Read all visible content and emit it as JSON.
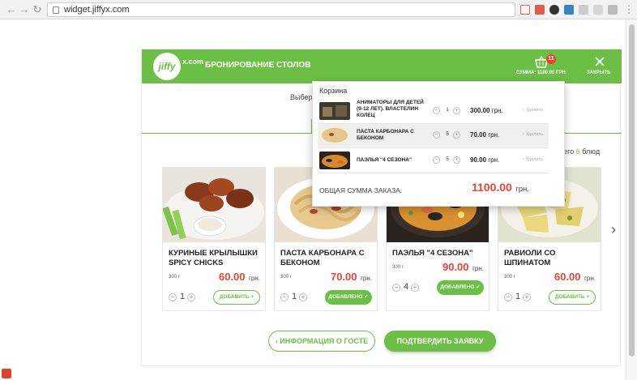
{
  "browser": {
    "url": "widget.jiffyx.com",
    "back_icon": "arrow-left-icon",
    "forward_icon": "arrow-right-icon",
    "reload_icon": "reload-icon"
  },
  "header": {
    "logo_text": "jiffy",
    "logo_suffix": "x.com",
    "title": "БРОНИРОВАНИЕ СТОЛОВ",
    "cart_badge": "11",
    "cart_sum": "СУММА: 1100.00 ГРН.",
    "close_label": "ЗАКРЫТЬ"
  },
  "main": {
    "subtitle": "Выбери",
    "count_prefix": "всего ",
    "count_num": "6",
    "count_suffix": " блюд"
  },
  "cards": [
    {
      "name": "КУРИНЫЕ КРЫЛЫШКИ SPICY CHICKS",
      "weight": "300 г",
      "price": "60.00",
      "currency": "грн.",
      "qty": "1",
      "button": "ДОБАВИТЬ +",
      "added": false
    },
    {
      "name": "ПАСТА КАРБОНАРА С БЕКОНОМ",
      "weight": "300 г",
      "price": "70.00",
      "currency": "грн.",
      "qty": "1",
      "button": "ДОБАВЛЕНО ✓",
      "added": true
    },
    {
      "name": "ПАЭЛЬЯ \"4 СЕЗОНА\"",
      "weight": "300 г",
      "price": "90.00",
      "currency": "грн.",
      "qty": "4",
      "button": "ДОБАВЛЕНО ✓",
      "added": true
    },
    {
      "name": "РАВИОЛИ СО ШПИНАТОМ",
      "weight": "300 г",
      "price": "60.00",
      "currency": "грн.",
      "qty": "1",
      "button": "ДОБАВИТЬ +",
      "added": false
    }
  ],
  "buttons": {
    "guest_info": "‹ ИНФОРМАЦИЯ О ГОСТЕ",
    "confirm": "ПОДТВЕРДИТЬ ЗАЯВКУ"
  },
  "cart_popup": {
    "title": "Корзина",
    "items": [
      {
        "name": "АНИМАТОРЫ ДЛЯ ДЕТЕЙ (9-12 ЛЕТ). ВЛАСТЕЛИН КОЛЕЦ",
        "qty": "1",
        "price": "300.00",
        "currency": "грн.",
        "remove": "Удалить"
      },
      {
        "name": "ПАСТА КАРБОНАРА С БЕКОНОМ",
        "qty": "5",
        "price": "70.00",
        "currency": "грн.",
        "remove": "Удалить"
      },
      {
        "name": "ПАЭЛЬЯ \"4 СЕЗОНА\"",
        "qty": "5",
        "price": "90.00",
        "currency": "грн.",
        "remove": "Удалить"
      }
    ],
    "total_label": "ОБЩАЯ СУММА ЗАКАЗА:",
    "total_value": "1100.00",
    "total_currency": "грн."
  },
  "colors": {
    "accent": "#6cbf45",
    "price": "#e84335",
    "badge": "#e8412c"
  }
}
